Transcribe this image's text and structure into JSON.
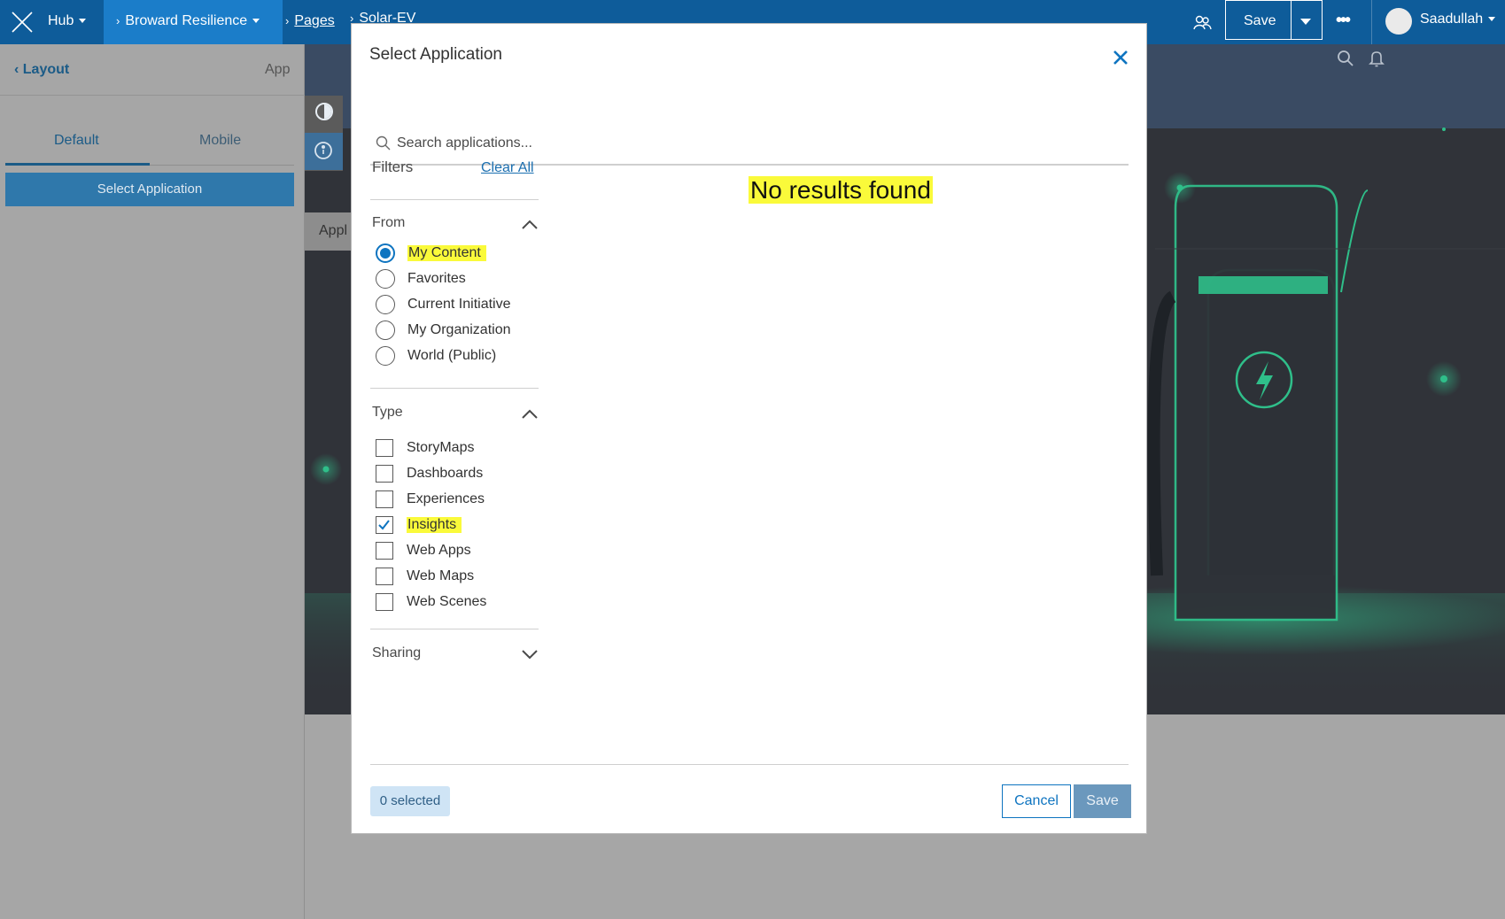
{
  "topbar": {
    "hub_label": "Hub",
    "site_label": "Broward Resilience",
    "pages_label": "Pages",
    "page_label": "Solar-EV",
    "save_label": "Save",
    "more_label": "•••",
    "user_name": "Saadullah"
  },
  "left_panel": {
    "back_label": "Layout",
    "section_label": "App",
    "tabs": [
      "Default",
      "Mobile"
    ],
    "active_tab": "Default",
    "select_button_label": "Select Application"
  },
  "preview": {
    "app_tab_label": "Appl"
  },
  "modal": {
    "title": "Select Application",
    "search": {
      "placeholder": "Search applications...",
      "value": ""
    },
    "filters_title": "Filters",
    "clear_all_label": "Clear All",
    "from": {
      "label": "From",
      "expanded": true,
      "options": [
        "My Content",
        "Favorites",
        "Current Initiative",
        "My Organization",
        "World (Public)"
      ],
      "selected": "My Content"
    },
    "type": {
      "label": "Type",
      "expanded": true,
      "options": [
        "StoryMaps",
        "Dashboards",
        "Experiences",
        "Insights",
        "Web Apps",
        "Web Maps",
        "Web Scenes"
      ],
      "checked": [
        "Insights"
      ]
    },
    "sharing": {
      "label": "Sharing",
      "expanded": false
    },
    "results_message": "No results found",
    "selected_count_label": "0 selected",
    "cancel_label": "Cancel",
    "save_label": "Save"
  },
  "colors": {
    "topbar": "#0e5c9a",
    "topbar_active": "#1b7dc9",
    "accent": "#0e74c0",
    "highlight": "#fafa3a",
    "overlay": "#a6a6a6",
    "preview_bg": "#303339",
    "ev_green": "#2fbf8a"
  }
}
